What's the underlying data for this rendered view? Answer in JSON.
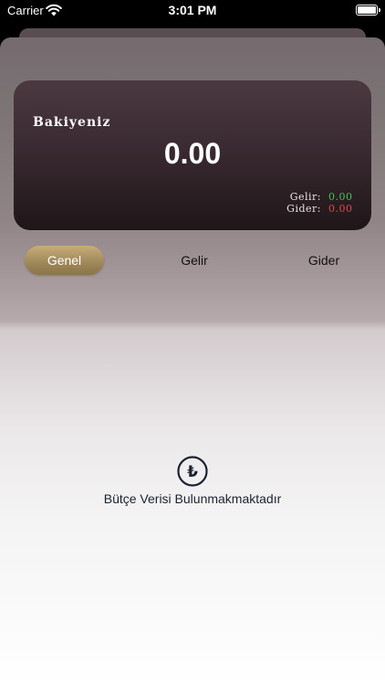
{
  "status_bar": {
    "carrier": "Carrier",
    "time": "3:01 PM",
    "icons": [
      "wifi-icon",
      "battery-icon"
    ]
  },
  "balance_card": {
    "title": "Bakiyeniz",
    "amount": "0.00",
    "income_label": "Gelir:",
    "income_value": "0.00",
    "expense_label": "Gider:",
    "expense_value": "0.00"
  },
  "tabs": [
    {
      "label": "Genel",
      "selected": true
    },
    {
      "label": "Gelir",
      "selected": false
    },
    {
      "label": "Gider",
      "selected": false
    }
  ],
  "empty_state": {
    "icon": "lira-icon",
    "icon_glyph": "₺",
    "message": "Bütçe Verisi Bulunmakmaktadır"
  },
  "colors": {
    "income": "#3ec55a",
    "expense": "#e04848",
    "accent_gold": "#b59a66",
    "card_dark": "#3a2a31",
    "text_navy": "#1b2333"
  }
}
